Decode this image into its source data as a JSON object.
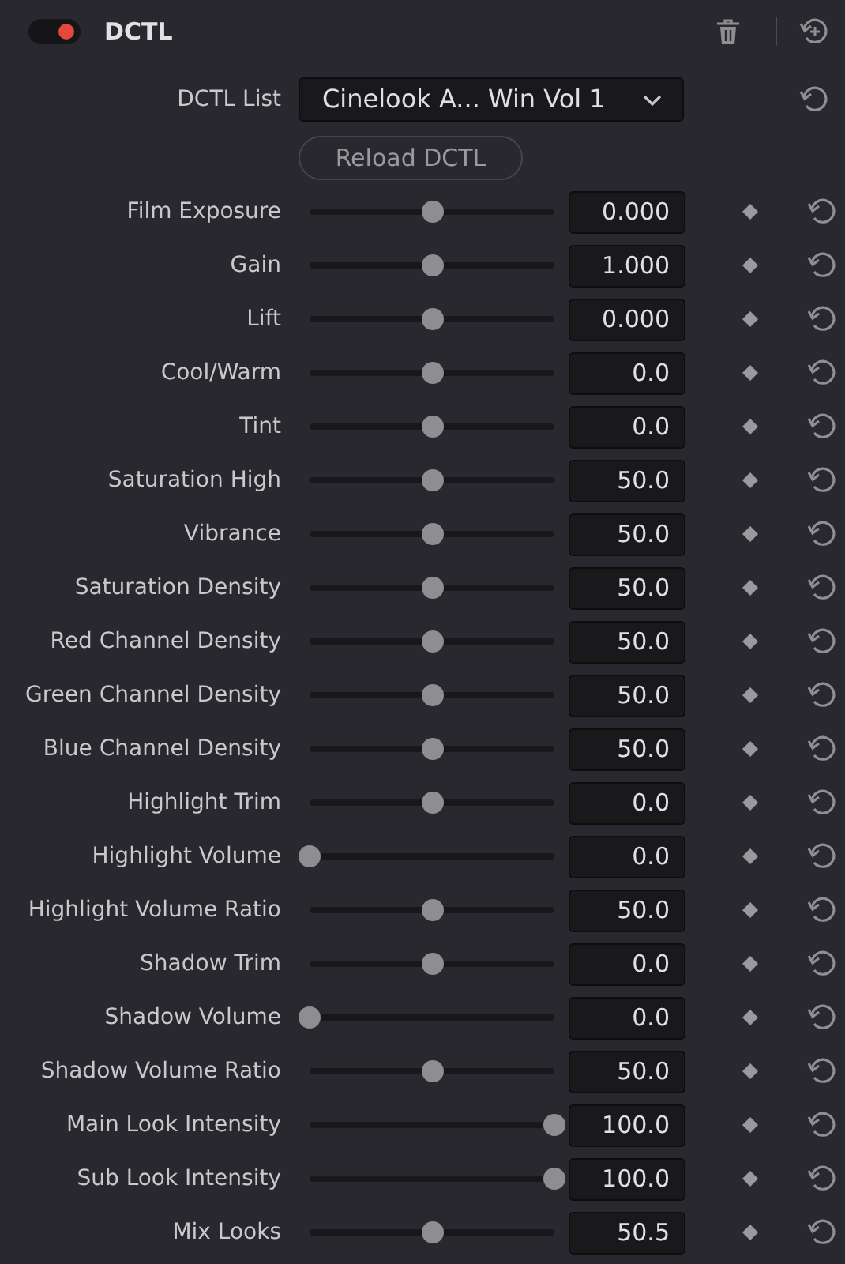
{
  "panel": {
    "title": "DCTL",
    "enabled": true
  },
  "dctl_list": {
    "label": "DCTL List",
    "value": "Cinelook A... Win Vol 1"
  },
  "reload_button": "Reload DCTL",
  "params": [
    {
      "label": "Film Exposure",
      "value": "0.000",
      "level": 0.5
    },
    {
      "label": "Gain",
      "value": "1.000",
      "level": 0.5
    },
    {
      "label": "Lift",
      "value": "0.000",
      "level": 0.5
    },
    {
      "label": "Cool/Warm",
      "value": "0.0",
      "level": 0.5
    },
    {
      "label": "Tint",
      "value": "0.0",
      "level": 0.5
    },
    {
      "label": "Saturation High",
      "value": "50.0",
      "level": 0.5
    },
    {
      "label": "Vibrance",
      "value": "50.0",
      "level": 0.5
    },
    {
      "label": "Saturation Density",
      "value": "50.0",
      "level": 0.5
    },
    {
      "label": "Red Channel Density",
      "value": "50.0",
      "level": 0.5
    },
    {
      "label": "Green Channel Density",
      "value": "50.0",
      "level": 0.5
    },
    {
      "label": "Blue Channel Density",
      "value": "50.0",
      "level": 0.5
    },
    {
      "label": "Highlight Trim",
      "value": "0.0",
      "level": 0.5
    },
    {
      "label": "Highlight Volume",
      "value": "0.0",
      "level": 0
    },
    {
      "label": "Highlight Volume Ratio",
      "value": "50.0",
      "level": 0.5
    },
    {
      "label": "Shadow Trim",
      "value": "0.0",
      "level": 0.5
    },
    {
      "label": "Shadow Volume",
      "value": "0.0",
      "level": 0
    },
    {
      "label": "Shadow Volume Ratio",
      "value": "50.0",
      "level": 0.5
    },
    {
      "label": "Main Look Intensity",
      "value": "100.0",
      "level": 1
    },
    {
      "label": "Sub Look Intensity",
      "value": "100.0",
      "level": 1
    },
    {
      "label": "Mix Looks",
      "value": "50.5",
      "level": 0.505
    }
  ]
}
